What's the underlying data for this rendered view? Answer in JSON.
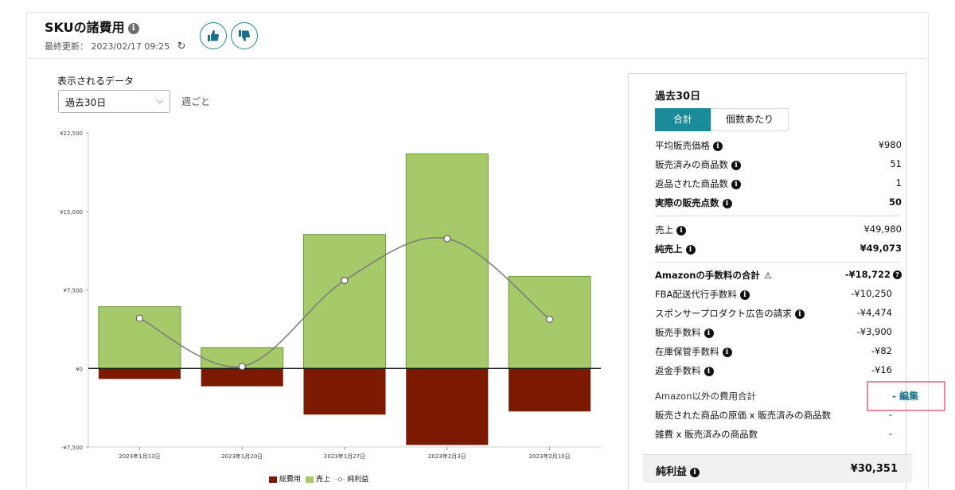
{
  "header": {
    "title": "SKUの諸費用",
    "updated_label": "最終更新：",
    "updated_value": "2023/02/17 09:25"
  },
  "controls": {
    "data_label": "表示されるデータ",
    "period_selected": "過去30日",
    "interval": "週ごと"
  },
  "chart_data": {
    "type": "bar",
    "categories": [
      "2023年1月13日",
      "2023年1月20日",
      "2023年1月27日",
      "2023年2月3日",
      "2023年2月10日"
    ],
    "ylim": [
      -7500,
      22500
    ],
    "yticks": [
      "¥22,500",
      "¥15,000",
      "¥7,500",
      "¥0",
      "-¥7,500"
    ],
    "yticks_values": [
      22500,
      15000,
      7500,
      0,
      -7500
    ],
    "series": [
      {
        "name": "総費用",
        "type": "bar",
        "color": "#7b1a00",
        "values": [
          -1000,
          -1700,
          -4400,
          -7300,
          -4100
        ]
      },
      {
        "name": "売上",
        "type": "bar",
        "color": "#a6c96a",
        "values": [
          5900,
          2000,
          12800,
          20500,
          8800
        ]
      },
      {
        "name": "純利益",
        "type": "line",
        "color": "#7a7a7a",
        "values": [
          4800,
          200,
          8400,
          12400,
          4700
        ]
      }
    ]
  },
  "panel": {
    "title": "過去30日",
    "tab_total": "合計",
    "tab_per_unit": "個数あたり",
    "rows1": [
      {
        "label": "平均販売価格",
        "value": "¥980"
      },
      {
        "label": "販売済みの商品数",
        "value": "51"
      },
      {
        "label": "返品された商品数",
        "value": "1"
      },
      {
        "label": "実際の販売点数",
        "value": "50"
      }
    ],
    "sales_label": "売上",
    "sales_value": "¥49,980",
    "net_sales_label": "純売上",
    "net_sales_value": "¥49,073",
    "fees_total_label": "Amazonの手数料の合計",
    "fees_total_value": "-¥18,722",
    "fees": [
      {
        "label": "FBA配送代行手数料",
        "value": "-¥10,250"
      },
      {
        "label": "スポンサープロダクト広告の請求",
        "value": "-¥4,474"
      },
      {
        "label": "販売手数料",
        "value": "-¥3,900"
      },
      {
        "label": "在庫保管手数料",
        "value": "-¥82"
      },
      {
        "label": "返金手数料",
        "value": "-¥16"
      }
    ],
    "other_costs_label": "Amazon以外の費用合計",
    "other_costs_edit": "- 編集",
    "cogs_label": "販売された商品の原価 x 販売済みの商品数",
    "cogs_value": "-",
    "misc_label": "雑費 x 販売済みの商品数",
    "misc_value": "-",
    "net_profit_label": "純利益",
    "net_profit_value": "¥30,351"
  }
}
